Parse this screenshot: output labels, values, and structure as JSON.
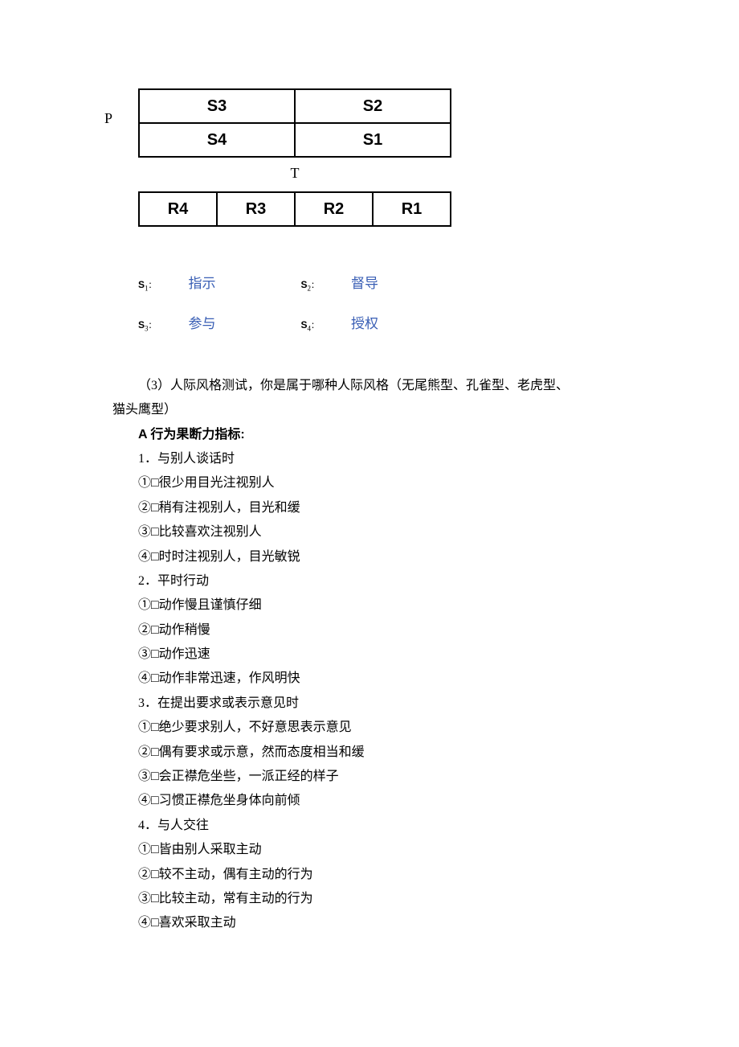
{
  "diagram": {
    "p_label": "P",
    "t_label": "T",
    "quad": {
      "tl": "S3",
      "tr": "S2",
      "bl": "S4",
      "br": "S1"
    },
    "r_row": [
      "R4",
      "R3",
      "R2",
      "R1"
    ]
  },
  "legend": {
    "s1_key": "S",
    "s1_sub": "1",
    "s1_colon": "：",
    "s1_val": "指示",
    "s2_key": "S",
    "s2_sub": "2",
    "s2_colon": "：",
    "s2_val": "督导",
    "s3_key": "S",
    "s3_sub": "3",
    "s3_colon": "：",
    "s3_val": "参与",
    "s4_key": "S",
    "s4_sub": "4",
    "s4_colon": "：",
    "s4_val": "授权"
  },
  "intro_line1": "（3）人际风格测试，你是属于哪种人际风格（无尾熊型、孔雀型、老虎型、",
  "intro_line2": "猫头鹰型）",
  "section_a_title": "A 行为果断力指标:",
  "questions": [
    {
      "q": "1．与别人谈话时",
      "opts": [
        "①□很少用目光注视别人",
        "②□稍有注视别人，目光和缓",
        "③□比较喜欢注视别人",
        "④□时时注视别人，目光敏锐"
      ]
    },
    {
      "q": "2．平时行动",
      "opts": [
        "①□动作慢且谨慎仔细",
        "②□动作稍慢",
        "③□动作迅速",
        "④□动作非常迅速，作风明快"
      ]
    },
    {
      "q": "3．在提出要求或表示意见时",
      "opts": [
        "①□绝少要求别人，不好意思表示意见",
        "②□偶有要求或示意，然而态度相当和缓",
        "③□会正襟危坐些，一派正经的样子",
        "④□习惯正襟危坐身体向前倾"
      ]
    },
    {
      "q": "4．与人交往",
      "opts": [
        "①□皆由别人采取主动",
        "②□较不主动，偶有主动的行为",
        "③□比较主动，常有主动的行为",
        "④□喜欢采取主动"
      ]
    }
  ]
}
